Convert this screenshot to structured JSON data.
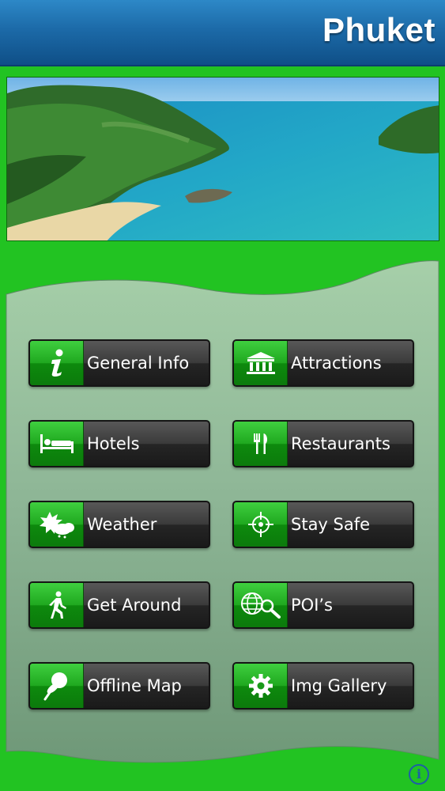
{
  "header": {
    "title": "Phuket"
  },
  "colors": {
    "header_blue": "#1c6aa8",
    "background_green": "#22c322",
    "button_icon_green": "#1fa81f",
    "button_dark": "#2a2a2a"
  },
  "menu": [
    {
      "label": "General Info",
      "icon": "info-icon"
    },
    {
      "label": "Attractions",
      "icon": "museum-icon"
    },
    {
      "label": "Hotels",
      "icon": "bed-icon"
    },
    {
      "label": "Restaurants",
      "icon": "fork-knife-icon"
    },
    {
      "label": "Weather",
      "icon": "weather-icon"
    },
    {
      "label": "Stay Safe",
      "icon": "crosshair-icon"
    },
    {
      "label": "Get Around",
      "icon": "walking-person-icon"
    },
    {
      "label": "POI’s",
      "icon": "globe-search-icon"
    },
    {
      "label": "Offline Map",
      "icon": "pushpin-icon"
    },
    {
      "label": "Img Gallery",
      "icon": "gear-icon"
    }
  ],
  "footer": {
    "info_glyph": "i"
  }
}
